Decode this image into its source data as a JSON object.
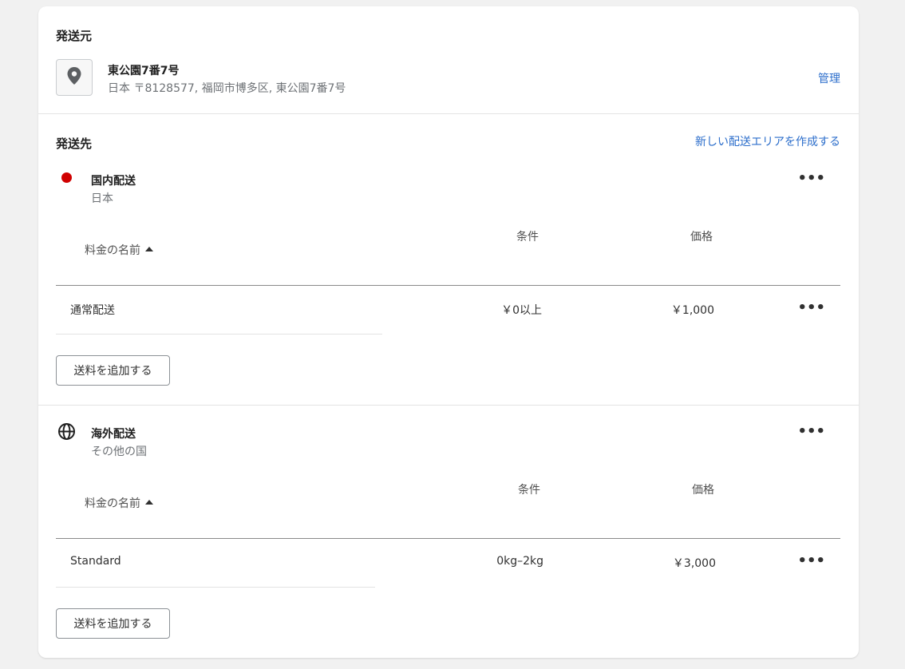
{
  "origin": {
    "heading": "発送元",
    "address_title": "東公園7番7号",
    "address_detail": "日本 〒8128577, 福岡市博多区, 東公園7番7号",
    "manage_link": "管理",
    "icon": "location-pin-icon"
  },
  "destination": {
    "heading": "発送先",
    "create_zone_link": "新しい配送エリアを作成する"
  },
  "zones": [
    {
      "name": "国内配送",
      "countries": "日本",
      "icon": "red-dot-flag-icon",
      "columns": {
        "rate_name": "料金の名前",
        "condition": "条件",
        "price": "価格"
      },
      "rates": [
        {
          "name": "通常配送",
          "condition": "￥0以上",
          "price": "￥1,000"
        }
      ],
      "add_rate_label": "送料を追加する",
      "more_label": "•••"
    },
    {
      "name": "海外配送",
      "countries": "その他の国",
      "icon": "globe-icon",
      "columns": {
        "rate_name": "料金の名前",
        "condition": "条件",
        "price": "価格"
      },
      "rates": [
        {
          "name": "Standard",
          "condition": "0kg–2kg",
          "price": "￥3,000"
        }
      ],
      "add_rate_label": "送料を追加する",
      "more_label": "•••"
    }
  ],
  "colors": {
    "link": "#2c6ecb",
    "domestic_flag": "#d00000",
    "background": "#f1f1f1"
  }
}
